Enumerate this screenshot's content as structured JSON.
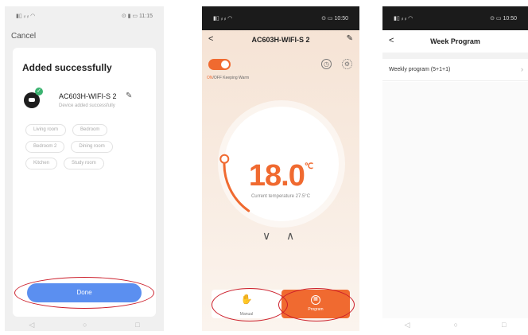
{
  "phone1": {
    "status": {
      "left": "▮▯ ᵢₗ ᵢₗ ◠",
      "right": "⊙ ▮ ▭ 11:15"
    },
    "cancel": "Cancel",
    "card_title": "Added successfully",
    "device_name": "AC603H-WIFI-S 2",
    "device_status": "Device added successfully",
    "rooms": [
      "Living room",
      "Bedroom",
      "Bedroom 2",
      "Dining room",
      "Kitchen",
      "Study room"
    ],
    "done": "Done",
    "nav": [
      "◁",
      "○",
      "□"
    ]
  },
  "phone2": {
    "status": {
      "left": "▮▯ ᵢₗ ᵢₗ ◠",
      "right": "⊙ ▭ 10:50"
    },
    "title": "AC603H-WIFI-S 2",
    "onoff_on": "ON",
    "onoff_rest": "/OFF Keeping Warm",
    "temperature": "18.0",
    "unit": "℃",
    "current_temp": "Current temperature 27.5°C",
    "manual": "Manual",
    "program": "Program",
    "dial_level": 0.5
  },
  "phone3": {
    "status": {
      "left": "▮▯ ᵢₗ ᵢₗ ◠",
      "right": "⊙ ▭ 10:50"
    },
    "title": "Week Program",
    "item": "Weekly program (5+1+1)",
    "nav": [
      "◁",
      "○",
      "□"
    ]
  },
  "colors": {
    "accent": "#f06a30",
    "done": "#5b8ff0",
    "annotation": "#cc1f2b"
  },
  "icons": [
    "back-icon",
    "edit-icon",
    "clock-icon",
    "gear-icon",
    "hand-icon",
    "program-icon",
    "chevron-right-icon"
  ]
}
